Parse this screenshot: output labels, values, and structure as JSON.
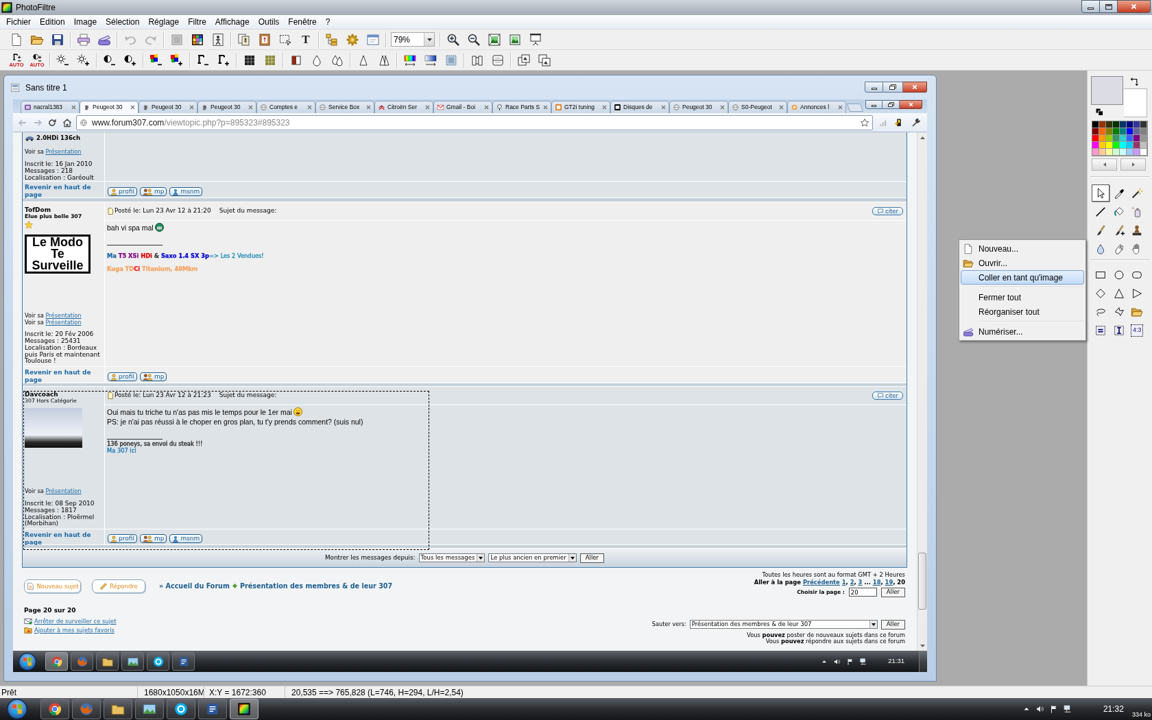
{
  "app": {
    "title": "PhotoFiltre",
    "menu": [
      "Fichier",
      "Edition",
      "Image",
      "Sélection",
      "Réglage",
      "Filtre",
      "Affichage",
      "Outils",
      "Fenêtre",
      "?"
    ],
    "text_tool": "T",
    "zoom": "79%",
    "auto_labels": [
      "AUTO",
      "AUTO"
    ]
  },
  "document": {
    "title": "Sans titre 1"
  },
  "browser": {
    "tabs": [
      {
        "label": "nacral1383",
        "selected": false
      },
      {
        "label": "Peugeot 30",
        "selected": true
      },
      {
        "label": "Peugeot 30",
        "selected": false
      },
      {
        "label": "Peugeot 30",
        "selected": false
      },
      {
        "label": "Comptes e",
        "selected": false
      },
      {
        "label": "Service Box",
        "selected": false
      },
      {
        "label": "Citroën Ser",
        "selected": false
      },
      {
        "label": "Gmail - Boi",
        "selected": false
      },
      {
        "label": "Race Parts S",
        "selected": false
      },
      {
        "label": "GT2i tuning",
        "selected": false
      },
      {
        "label": "Disques de",
        "selected": false
      },
      {
        "label": "Peugeot 30",
        "selected": false
      },
      {
        "label": "S0-Peugeot",
        "selected": false
      },
      {
        "label": "Annonces l",
        "selected": false
      }
    ],
    "url_host": "www.forum307.com",
    "url_path": "/viewtopic.php?p=895323#895323"
  },
  "forum": {
    "posts": [
      {
        "kind": "partial",
        "car": "2.0HDi 136ch",
        "profile_links": [
          {
            "text": "Voir sa",
            "link": "Présentation"
          }
        ],
        "info": [
          "Inscrit le: 16 Jan 2010",
          "Messages : 218",
          "Localisation : Garéoult"
        ],
        "back_to_top": "Revenir en haut de page",
        "actions": [
          "profil",
          "mp",
          "msnm"
        ]
      },
      {
        "kind": "full",
        "author": "TofDom",
        "rank": "Elue plus belle 307",
        "rank_bold": true,
        "star": true,
        "avatar": {
          "kind": "sign",
          "text": "Le Modo Te Surveille"
        },
        "profile_links": [
          {
            "text": "Voir sa",
            "link": "Présentation"
          },
          {
            "text": "Voir sa",
            "link": "Présentation"
          }
        ],
        "info": [
          "Inscrit le: 20 Fév 2006",
          "Messages : 25431",
          "Localisation : Bordeaux puis Paris et maintenant Toulouse !"
        ],
        "posted": "Posté le: Lun 23 Avr 12 à 21:20",
        "subject_label": "Sujet du message:",
        "quote": "citer",
        "body": [
          {
            "text": "bah vi spa mal",
            "emoticon": true
          }
        ],
        "signature": [
          [
            {
              "text": "Ma",
              "color": "#1d6aa5",
              "bold": true
            },
            {
              "text": " T5 XSi",
              "color": "#800080",
              "bold": true
            },
            {
              "text": " HDi",
              "color": "#dd0000",
              "bold": true
            },
            {
              "text": " &",
              "color": "#333333",
              "bold": true
            },
            {
              "text": " Saxo 1.4 SX 3p",
              "color": "#0000cc",
              "bold": true
            },
            {
              "text": "=> Les 2 Vendues!",
              "color": "#1b8bb5",
              "bold": false
            }
          ],
          [
            {
              "text": "Kuga TD",
              "color": "#f4a460",
              "bold": true
            },
            {
              "text": "Ci",
              "color": "#ee1111",
              "bold": true
            },
            {
              "text": " Titanium, 48Mkm",
              "color": "#f4a460",
              "bold": true
            }
          ]
        ],
        "back_to_top": "Revenir en haut de page",
        "actions": [
          "profil",
          "mp"
        ]
      },
      {
        "kind": "full",
        "author": "Davcoach",
        "rank": "307 Hors Catégorie",
        "rank_bold": false,
        "star": false,
        "avatar": {
          "kind": "photo"
        },
        "profile_links": [
          {
            "text": "Voir sa",
            "link": "Présentation"
          }
        ],
        "info": [
          "Inscrit le: 08 Sep 2010",
          "Messages : 1817",
          "Localisation : Ploërmel (Morbihan)"
        ],
        "posted": "Posté le: Lun 23 Avr 12 à 21:23",
        "subject_label": "Sujet du message:",
        "quote": "citer",
        "body": [
          {
            "text": "Oui mais tu triche tu n'as pas mis le temps pour le 1er mai",
            "emoticon": true
          },
          {
            "text": "PS: je n'ai pas réussi à le choper en gros plan, tu t'y prends comment? (suis nul)",
            "emoticon": false
          }
        ],
        "signature": [
          [
            {
              "text": "136 poneys, sa envoi du steak !!!",
              "color": "#222222",
              "bold": false
            }
          ],
          [
            {
              "text": "Ma 307 ici",
              "color": "#1f78b4",
              "bold": false
            }
          ]
        ],
        "back_to_top": "Revenir en haut de page",
        "actions": [
          "profil",
          "mp",
          "msnm"
        ]
      }
    ],
    "filter": {
      "label": "Montrer les messages depuis:",
      "selects": [
        "Tous les messages",
        "Le plus ancien en premier"
      ],
      "button": "Aller"
    },
    "topic_buttons": [
      "Nouveau sujet",
      "Répondre"
    ],
    "breadcrumb": [
      "» Accueil du Forum",
      "Présentation des membres & de leur 307"
    ],
    "timezone": "Toutes les heures sont au format GMT + 2 Heures",
    "pagination": [
      {
        "kind": "label",
        "text": "Aller à la page"
      },
      {
        "kind": "link",
        "text": "Précédente"
      },
      {
        "kind": "link",
        "text": "1"
      },
      {
        "kind": "comma",
        "text": ","
      },
      {
        "kind": "link",
        "text": "2"
      },
      {
        "kind": "comma",
        "text": ","
      },
      {
        "kind": "link",
        "text": "3"
      },
      {
        "kind": "gap",
        "text": "..."
      },
      {
        "kind": "link",
        "text": "18"
      },
      {
        "kind": "comma",
        "text": ","
      },
      {
        "kind": "link",
        "text": "19"
      },
      {
        "kind": "comma",
        "text": ","
      },
      {
        "kind": "current",
        "text": "20"
      }
    ],
    "page_choice": {
      "label": "Choisir la page :",
      "value": "20",
      "button": "Aller"
    },
    "page_count": "Page 20 sur 20",
    "topic_links": [
      "Arrêter de surveiller ce sujet",
      "Ajouter à mes sujets favoris"
    ],
    "jump": {
      "label": "Sauter vers:",
      "value": "Présentation des membres & de leur 307",
      "button": "Aller"
    },
    "permissions": [
      "Vous **pouvez** poster de nouveaux sujets dans ce forum",
      "Vous **pouvez** répondre aux sujets dans ce forum"
    ]
  },
  "inner_taskbar": {
    "time": "21:31"
  },
  "context_menu": {
    "groups": [
      [
        {
          "label": "Nouveau...",
          "selected": false
        },
        {
          "label": "Ouvrir...",
          "selected": false
        },
        {
          "label": "Coller en tant qu'image",
          "selected": true
        }
      ],
      [
        {
          "label": "Fermer tout",
          "selected": false
        },
        {
          "label": "Réorganiser tout",
          "selected": false
        }
      ],
      [
        {
          "label": "Numériser...",
          "selected": false
        }
      ]
    ]
  },
  "tool_panel": {
    "swatches": [
      {
        "kind": "background",
        "color": "#ffffff"
      },
      {
        "kind": "foreground",
        "color": "#dcdce5"
      }
    ],
    "palette": [
      {
        "color": "#000000"
      },
      {
        "color": "#993300"
      },
      {
        "color": "#333300"
      },
      {
        "color": "#003300"
      },
      {
        "color": "#003366"
      },
      {
        "color": "#000080"
      },
      {
        "color": "#333399"
      },
      {
        "color": "#333333"
      },
      {
        "color": "#800000"
      },
      {
        "color": "#ff6600"
      },
      {
        "color": "#808000"
      },
      {
        "color": "#008000"
      },
      {
        "color": "#008080"
      },
      {
        "color": "#0000ff"
      },
      {
        "color": "#666699"
      },
      {
        "color": "#808080"
      },
      {
        "color": "#ff0000"
      },
      {
        "color": "#ff9900"
      },
      {
        "color": "#99cc00"
      },
      {
        "color": "#339966"
      },
      {
        "color": "#33cccc"
      },
      {
        "color": "#3366ff"
      },
      {
        "color": "#800080"
      },
      {
        "color": "#969696"
      },
      {
        "color": "#ff00ff"
      },
      {
        "color": "#ffcc00"
      },
      {
        "color": "#ffff00"
      },
      {
        "color": "#00ff00"
      },
      {
        "color": "#00ffff"
      },
      {
        "color": "#00ccff"
      },
      {
        "color": "#993366"
      },
      {
        "color": "#c0c0c0"
      },
      {
        "color": "#ff99cc"
      },
      {
        "color": "#ffcc99"
      },
      {
        "color": "#ffff99"
      },
      {
        "color": "#ccffcc"
      },
      {
        "color": "#ccffff"
      },
      {
        "color": "#99ccff"
      },
      {
        "color": "#cc99ff"
      },
      {
        "color": "#ffffff"
      }
    ],
    "tools": [
      {
        "selected": true
      },
      {
        "selected": false
      },
      {
        "selected": false
      },
      {
        "selected": false
      },
      {
        "selected": false
      },
      {
        "selected": false
      },
      {
        "selected": false
      },
      {
        "selected": false
      },
      {
        "selected": false
      },
      {
        "selected": false
      },
      {
        "selected": false
      },
      {
        "selected": false
      }
    ],
    "ratio_label": "4:3"
  },
  "status_bar": [
    "Prêt",
    "1680x1050x16M",
    "X:Y = 1672:360",
    "20,535 ==> 765,828 (L=746, H=294, L/H=2,54)"
  ],
  "taskbar": {
    "time": "21:32",
    "meter": "334 ko"
  }
}
